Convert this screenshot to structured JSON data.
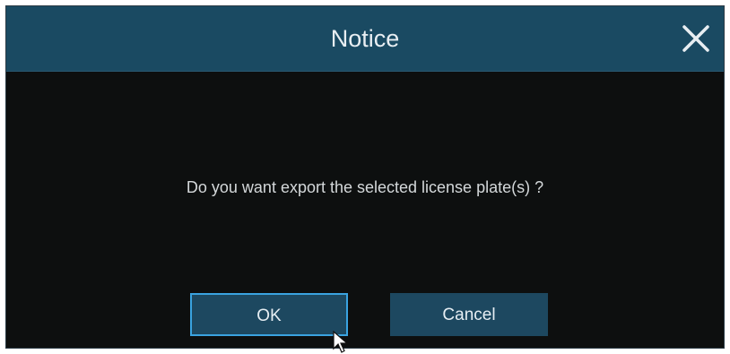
{
  "dialog": {
    "title": "Notice",
    "message": "Do you want export the selected license plate(s) ?",
    "ok_label": "OK",
    "cancel_label": "Cancel",
    "close_icon": "close-icon"
  },
  "colors": {
    "titlebar": "#1a4a62",
    "body": "#0d0f0f",
    "button": "#1d4860",
    "focus_border": "#3aa3e0",
    "text": "#e8eef2"
  }
}
